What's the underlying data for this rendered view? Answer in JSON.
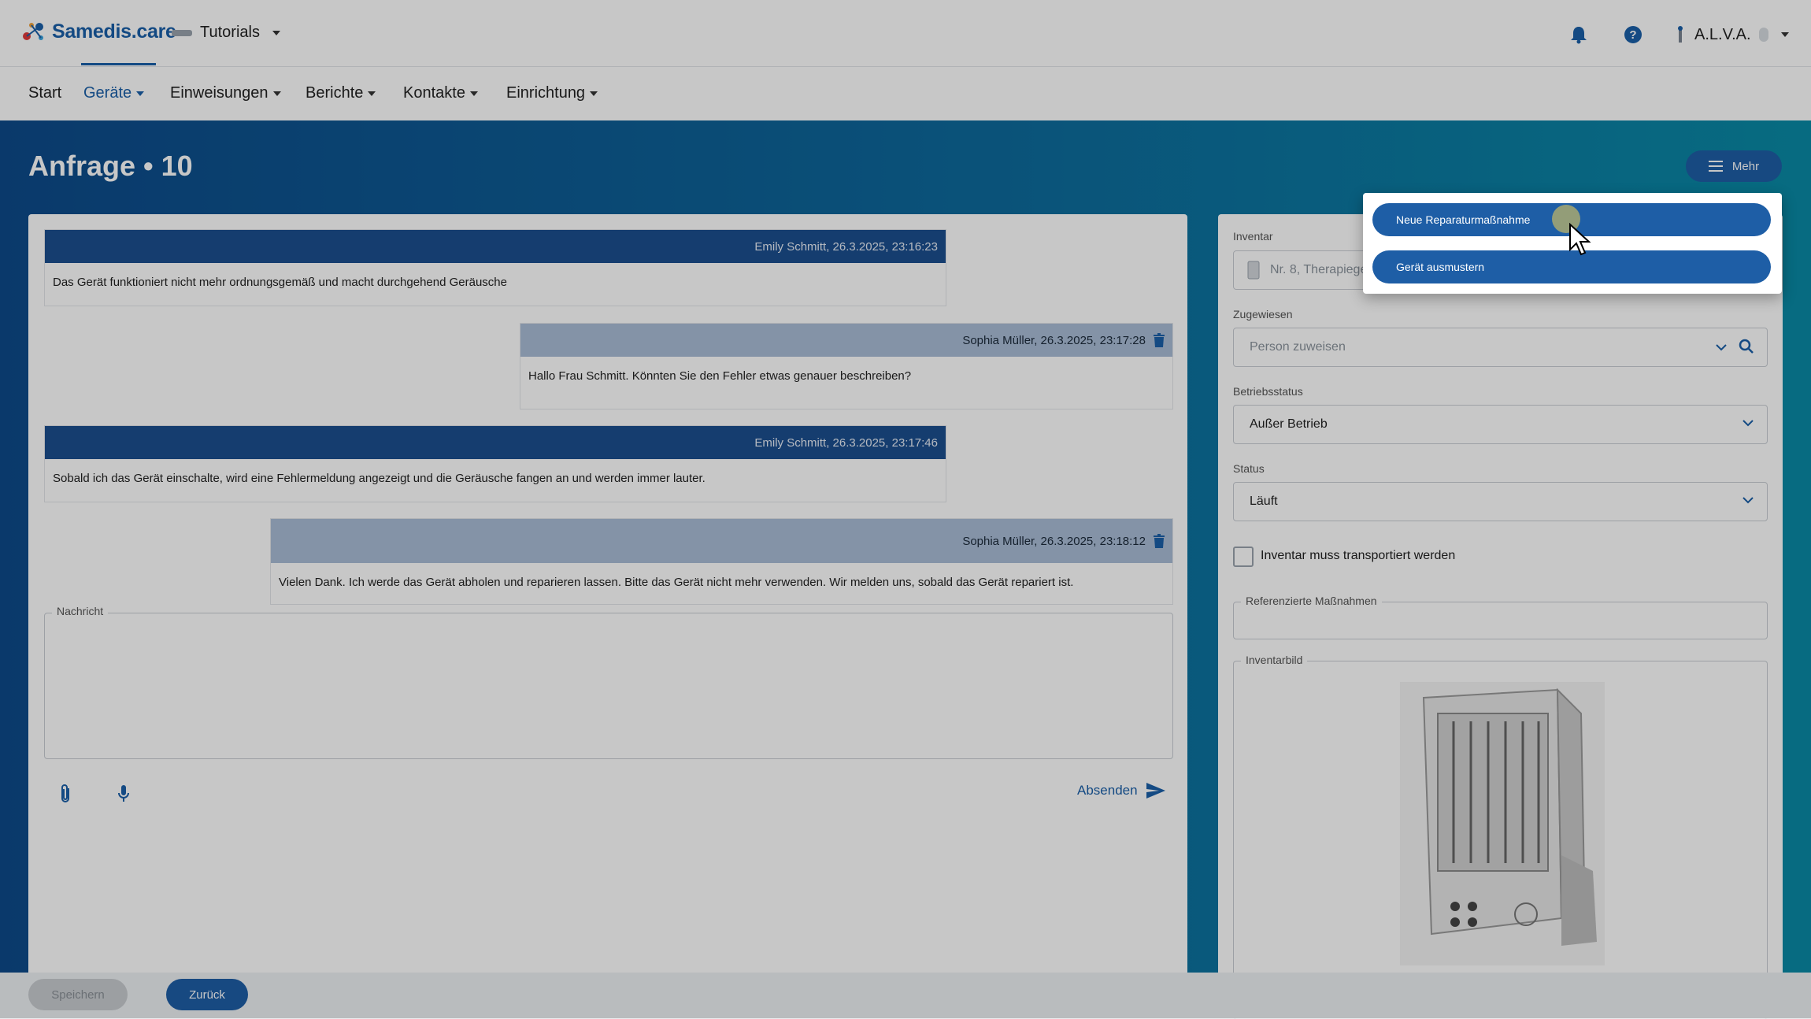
{
  "app": {
    "brand": "Samedis.care",
    "tenant": "Tutorials",
    "user": "A.L.V.A."
  },
  "nav": {
    "items": [
      {
        "label": "Start",
        "active": false,
        "dropdown": false
      },
      {
        "label": "Geräte",
        "active": true,
        "dropdown": true
      },
      {
        "label": "Einweisungen",
        "active": false,
        "dropdown": true
      },
      {
        "label": "Berichte",
        "active": false,
        "dropdown": true
      },
      {
        "label": "Kontakte",
        "active": false,
        "dropdown": true
      },
      {
        "label": "Einrichtung",
        "active": false,
        "dropdown": true
      }
    ]
  },
  "page": {
    "title": "Anfrage • 10",
    "more_label": "Mehr"
  },
  "messages": [
    {
      "author_time": "Emily Schmitt, 26.3.2025, 23:16:23",
      "text": "Das Gerät funktioniert nicht mehr ordnungsgemäß und macht durchgehend Geräusche",
      "direction": "in"
    },
    {
      "author_time": "Sophia Müller, 26.3.2025, 23:17:28",
      "text": "Hallo Frau Schmitt. Könnten Sie den Fehler etwas genauer beschreiben?",
      "direction": "out"
    },
    {
      "author_time": "Emily Schmitt, 26.3.2025, 23:17:46",
      "text": "Sobald ich das Gerät einschalte, wird eine Fehlermeldung angezeigt und die Geräusche fangen an und werden immer lauter.",
      "direction": "in"
    },
    {
      "author_time": "Sophia Müller, 26.3.2025, 23:18:12",
      "text": "Vielen Dank. Ich werde das Gerät abholen und reparieren lassen. Bitte das Gerät nicht mehr verwenden. Wir melden uns, sobald das Gerät repariert ist.",
      "direction": "out"
    }
  ],
  "composer": {
    "label": "Nachricht",
    "value": "",
    "send_label": "Absenden"
  },
  "sidebar": {
    "inventar_label": "Inventar",
    "inventar_value": "Nr. 8, Therapiege",
    "zugewiesen_label": "Zugewiesen",
    "zugewiesen_placeholder": "Person zuweisen",
    "betriebsstatus_label": "Betriebsstatus",
    "betriebsstatus_value": "Außer Betrieb",
    "status_label": "Status",
    "status_value": "Läuft",
    "transport_label": "Inventar muss transportiert werden",
    "transport_checked": false,
    "referenzen_label": "Referenzierte Maßnahmen",
    "bild_label": "Inventarbild"
  },
  "footer": {
    "save_label": "Speichern",
    "back_label": "Zurück"
  },
  "menu": {
    "items": [
      "Neue Reparaturmaßnahme",
      "Gerät ausmustern"
    ]
  },
  "colors": {
    "primary": "#1e5ea6",
    "incoming_header": "#1c4f8f",
    "outgoing_header": "#a9bdd6"
  }
}
